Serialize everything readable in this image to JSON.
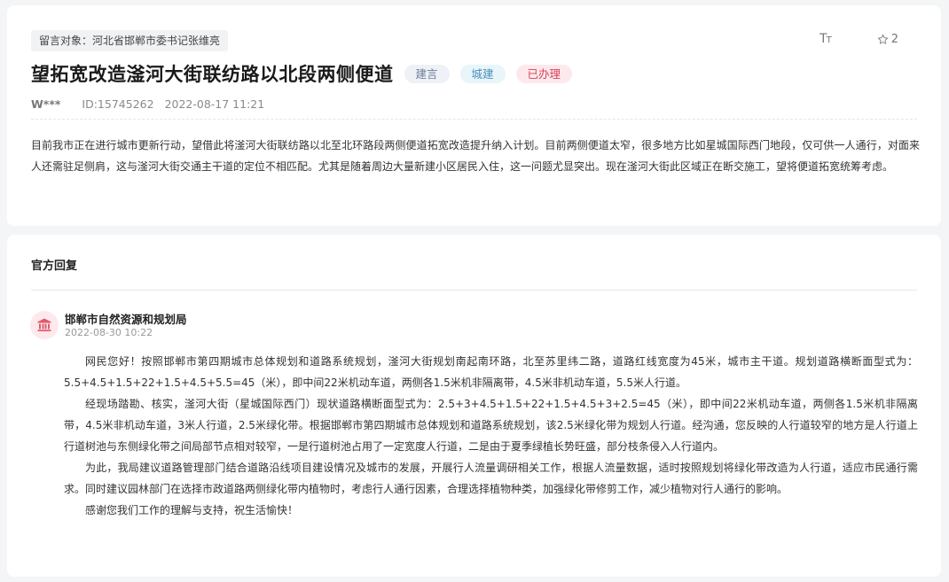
{
  "message": {
    "target": "留言对象：河北省邯郸市委书记张维亮",
    "title": "望拓宽改造滏河大街联纺路以北段两侧便道",
    "tags": {
      "type": "建言",
      "field": "城建",
      "status": "已办理"
    },
    "tools": {
      "font_size_label": "TT",
      "favorite_count": "2"
    },
    "author": "W***",
    "id": "ID:15745262",
    "date": "2022-08-17 11:21",
    "content": "目前我市正在进行城市更新行动，望借此将滏河大街联纺路以北至北环路段两侧便道拓宽改造提升纳入计划。目前两侧便道太窄，很多地方比如星城国际西门地段，仅可供一人通行，对面来人还需驻足侧肩，这与滏河大街交通主干道的定位不相匹配。尤其是随着周边大量新建小区居民入住，这一问题尤显突出。现在滏河大街此区域正在断交施工，望将便道拓宽统筹考虑。"
  },
  "reply": {
    "heading": "官方回复",
    "department": "邯郸市自然资源和规划局",
    "date": "2022-08-30 10:22",
    "paragraphs": [
      "网民您好！按照邯郸市第四期城市总体规划和道路系统规划，滏河大街规划南起南环路，北至苏里纬二路，道路红线宽度为45米，城市主干道。规划道路横断面型式为：5.5+4.5+1.5+22+1.5+4.5+5.5=45（米），即中间22米机动车道，两侧各1.5米机非隔离带，4.5米非机动车道，5.5米人行道。",
      "经现场踏勘、核实，滏河大街（星城国际西门）现状道路横断面型式为：2.5+3+4.5+1.5+22+1.5+4.5+3+2.5=45（米），即中间22米机动车道，两侧各1.5米机非隔离带，4.5米非机动车道，3米人行道，2.5米绿化带。根据邯郸市第四期城市总体规划和道路系统规划，该2.5米绿化带为规划人行道。经沟通，您反映的人行道较窄的地方是人行道上行道树池与东侧绿化带之间局部节点相对较窄，一是行道树池占用了一定宽度人行道，二是由于夏季绿植长势旺盛，部分枝条侵入人行道内。",
      "为此，我局建议道路管理部门结合道路沿线项目建设情况及城市的发展，开展行人流量调研相关工作，根据人流量数据，适时按照规划将绿化带改造为人行道，适应市民通行需求。同时建议园林部门在选择市政道路两侧绿化带内植物时，考虑行人通行因素，合理选择植物种类，加强绿化带修剪工作，减少植物对行人通行的影响。",
      "感谢您我们工作的理解与支持，祝生活愉快！"
    ]
  },
  "colors": {
    "status_red": "#d7415a",
    "field_blue": "#4a90b8",
    "type_gray": "#6d7d9a"
  },
  "icons": {
    "font_size": "font-size-icon",
    "favorite": "star-icon",
    "department": "government-building-icon"
  }
}
